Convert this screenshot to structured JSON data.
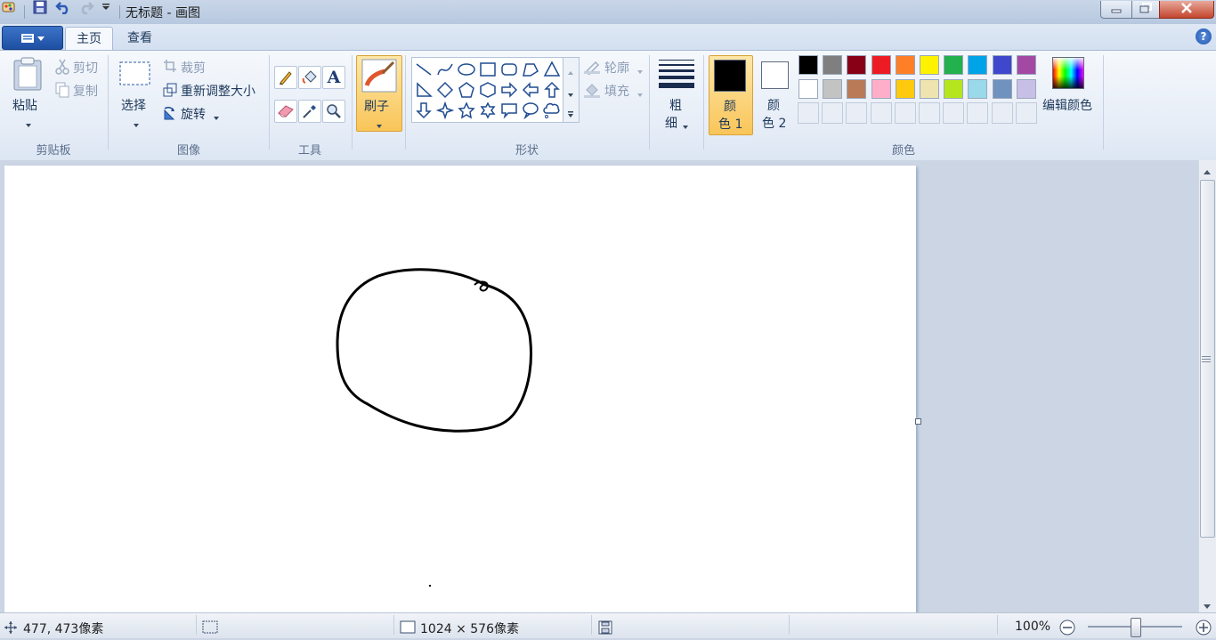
{
  "window": {
    "title": "无标题 - 画图",
    "minimize_icon": "minimize-icon",
    "maximize_icon": "restore-icon",
    "close_icon": "close-icon"
  },
  "quick_access": [
    "paint-app-icon",
    "save-icon",
    "undo-icon",
    "redo-icon",
    "customize-dropdown-icon"
  ],
  "tabs": [
    {
      "label": "主页",
      "active": true
    },
    {
      "label": "查看",
      "active": false
    }
  ],
  "ribbon": {
    "clipboard": {
      "group_label": "剪贴板",
      "paste_label": "粘贴",
      "cut_label": "剪切",
      "copy_label": "复制"
    },
    "image": {
      "group_label": "图像",
      "select_label": "选择",
      "crop_label": "裁剪",
      "resize_label": "重新调整大小",
      "rotate_label": "旋转"
    },
    "tools": {
      "group_label": "工具",
      "items": [
        "pencil-icon",
        "fill-bucket-icon",
        "text-icon",
        "eraser-icon",
        "color-picker-icon",
        "magnifier-icon"
      ]
    },
    "brushes": {
      "label": "刷子"
    },
    "shapes": {
      "group_label": "形状",
      "outline_label": "轮廓",
      "fill_label": "填充"
    },
    "size": {
      "label_line1": "粗",
      "label_line2": "细"
    },
    "colors": {
      "group_label": "颜色",
      "color1_line1": "颜",
      "color1_line2": "色 1",
      "color2_line1": "颜",
      "color2_line2": "色 2",
      "color1_value": "#000000",
      "color2_value": "#ffffff",
      "edit_colors_label": "编辑颜色",
      "palette_row1": [
        "#000000",
        "#7f7f7f",
        "#880015",
        "#ed1c24",
        "#ff7f27",
        "#fff200",
        "#22b14c",
        "#00a2e8",
        "#3f48cc",
        "#a349a4"
      ],
      "palette_row2": [
        "#ffffff",
        "#c3c3c3",
        "#b97a57",
        "#ffaec9",
        "#ffc90e",
        "#efe4b0",
        "#b5e61d",
        "#99d9ea",
        "#7092be",
        "#c8bfe7"
      ]
    }
  },
  "status": {
    "cursor_pos": "477, 473像素",
    "image_size": "1024 × 576像素",
    "zoom": "100%"
  }
}
